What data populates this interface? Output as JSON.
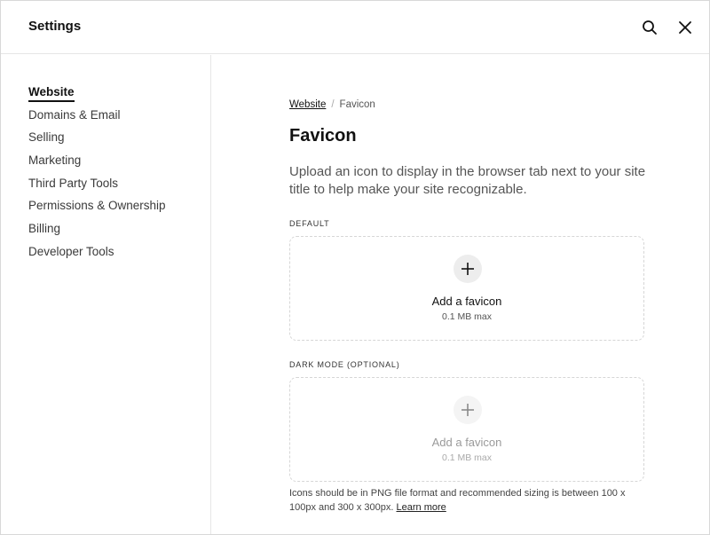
{
  "header": {
    "title": "Settings",
    "search_icon": "search-icon",
    "close_icon": "close-icon"
  },
  "sidebar": {
    "items": [
      {
        "label": "Website",
        "active": true
      },
      {
        "label": "Domains & Email"
      },
      {
        "label": "Selling"
      },
      {
        "label": "Marketing"
      },
      {
        "label": "Third Party Tools"
      },
      {
        "label": "Permissions & Ownership"
      },
      {
        "label": "Billing"
      },
      {
        "label": "Developer Tools"
      }
    ]
  },
  "main": {
    "breadcrumb": {
      "parent": "Website",
      "separator": "/",
      "current": "Favicon"
    },
    "title": "Favicon",
    "description": "Upload an icon to display in the browser tab next to your site title to help make your site recognizable.",
    "default_section": {
      "label": "DEFAULT",
      "add_label": "Add a favicon",
      "size_limit": "0.1 MB max",
      "icon": "plus-icon"
    },
    "dark_section": {
      "label": "DARK MODE (OPTIONAL)",
      "add_label": "Add a favicon",
      "size_limit": "0.1 MB max",
      "icon": "plus-icon"
    },
    "footnote": {
      "text": "Icons should be in PNG file format and recommended sizing is between 100 x 100px and 300 x 300px.",
      "link": "Learn more"
    }
  },
  "colors": {
    "text_primary": "#111111",
    "text_secondary": "#555555",
    "border": "#e6e6e6",
    "dashed_border": "#d6d6d6",
    "plus_circle_bg": "#ededed"
  }
}
